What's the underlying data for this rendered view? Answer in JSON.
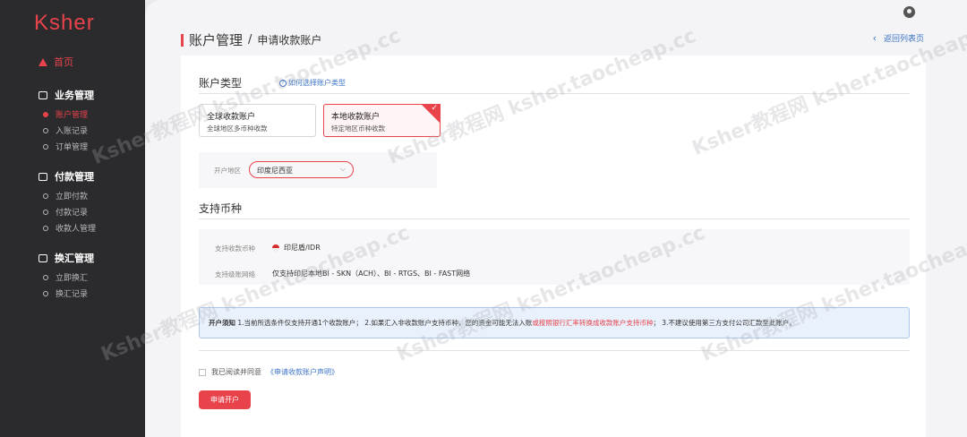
{
  "sidebar": {
    "logo": "Ksher",
    "home": "首页",
    "groups": [
      {
        "title": "业务管理",
        "items": [
          "账户管理",
          "入账记录",
          "订单管理"
        ]
      },
      {
        "title": "付款管理",
        "items": [
          "立即付款",
          "付款记录",
          "收款人管理"
        ]
      },
      {
        "title": "换汇管理",
        "items": [
          "立即换汇",
          "换汇记录"
        ]
      }
    ]
  },
  "header": {
    "title": "账户管理",
    "separator": "/",
    "subtitle": "申请收款账户",
    "back": "返回列表页"
  },
  "account_type": {
    "title": "账户类型",
    "help": "如何选择账户类型",
    "options": [
      {
        "title": "全球收款账户",
        "desc": "全球地区多币种收款",
        "selected": false
      },
      {
        "title": "本地收款账户",
        "desc": "特定地区币种收款",
        "selected": true
      }
    ],
    "region_label": "开户地区",
    "region_value": "印度尼西亚"
  },
  "currency": {
    "title": "支持币种",
    "currency_label": "支持收款币种",
    "currency_value": "印尼盾/IDR",
    "network_label": "支持级账网络",
    "network_value": "仅支持印尼本地BI - SKN（ACH）、BI - RTGS、BI - FAST网络"
  },
  "notice": {
    "bold": "开户须知",
    "text1": " 1.当前所选条件仅支持开通1个收款账户；  2.如果汇入非收款账户支持币种，您的资金可能无法入账",
    "red": "或按照银行汇率转换成收款账户支持币种",
    "text2": "；  3.不建议使用第三方支付公司汇款至此账户。"
  },
  "agreement": {
    "text": "我已阅读并同意",
    "link": "《申请收款账户声明》"
  },
  "apply_button": "申请开户",
  "watermark": "Ksher教程网 ksher.taocheap.cc",
  "colors": {
    "accent": "#e8424a",
    "link": "#3b73c7",
    "sidebar": "#2b2b2e"
  }
}
